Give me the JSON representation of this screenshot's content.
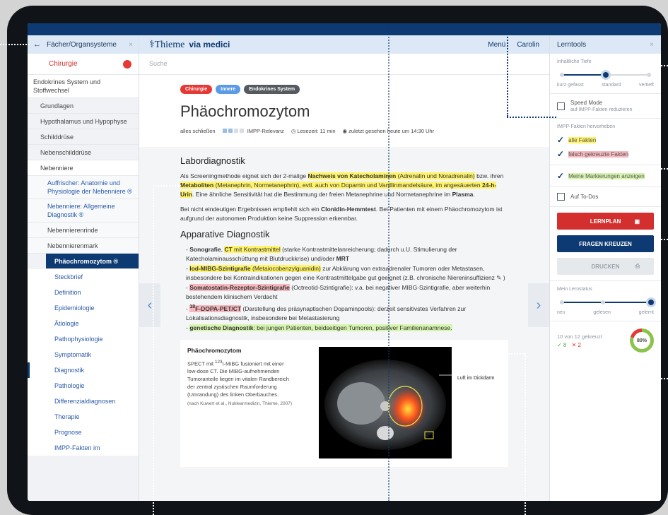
{
  "left": {
    "back_label": "Fächer/Organsysteme",
    "close": "×",
    "subject": "Chirurgie",
    "items": [
      {
        "label": "Endokrines System und Stoffwechsel"
      },
      {
        "label": "Grundlagen"
      },
      {
        "label": "Hypothalamus und Hypophyse"
      },
      {
        "label": "Schilddrüse"
      },
      {
        "label": "Nebenschilddrüse"
      },
      {
        "label": "Nebenniere"
      },
      {
        "label": "Auffrischer: Anatomie und Physiologie der Nebenniere ®"
      },
      {
        "label": "Nebenniere: Allgemeine Diagnostik ®"
      },
      {
        "label": "Nebennierenrinde"
      },
      {
        "label": "Nebennierenmark"
      },
      {
        "label": "Phäochromozytom ®"
      },
      {
        "label": "Steckbrief"
      },
      {
        "label": "Definition"
      },
      {
        "label": "Epidemiologie"
      },
      {
        "label": "Ätiologie"
      },
      {
        "label": "Pathophysiologie"
      },
      {
        "label": "Symptomatik"
      },
      {
        "label": "Diagnostik"
      },
      {
        "label": "Pathologie"
      },
      {
        "label": "Differenzialdiagnosen"
      },
      {
        "label": "Therapie"
      },
      {
        "label": "Prognose"
      },
      {
        "label": "IMPP-Fakten im"
      }
    ]
  },
  "header": {
    "logo": "Thieme",
    "logo_suffix": "via medici",
    "menu": "Menü",
    "user": "Carolin",
    "search_placeholder": "Suche"
  },
  "article": {
    "tags": [
      {
        "label": "Chirurgie",
        "color": "#e53935"
      },
      {
        "label": "Innere",
        "color": "#5b9be6"
      },
      {
        "label": "Endokrines System",
        "color": "#555a60"
      }
    ],
    "title": "Phäochromozytom",
    "close_all": "alles schließen",
    "impp": "IMPP-Relevanz",
    "impp_level": 2,
    "read_time": "Lesezeit: 11 min",
    "last_seen": "zuletzt gesehen heute um 14:30 Uhr",
    "lab_heading": "Labordiagnostik",
    "p1": {
      "a": "Als Screeningmethode eignet sich der 2-malige ",
      "b": "Nachweis von Katecholaminen",
      "c": " (Adrenalin und Noradrenalin)",
      "d": " bzw. ihren ",
      "e": "Metaboliten",
      "f": " (Metanephrin, Normetanephrin), evtl. auch von Dopamin und Vanillinmandelsäure, im angesäuerten ",
      "g": "24-h-Urin",
      "h": ". Eine ähnliche Sensitivität hat die Bestimmung der freien Metanephrine und Normetanephrine im ",
      "i": "Plasma",
      "j": "."
    },
    "p2": {
      "a": "Bei nicht eindeutigen Ergebnissen empfiehlt sich ein ",
      "b": "Clonidin-Hemmtest",
      "c": ". Bei Patienten mit einem Phäochromozytom ist aufgrund der autonomen Produktion keine Suppression erkennbar."
    },
    "app_heading": "Apparative Diagnostik",
    "items": [
      {
        "a": "Sonografie",
        "b": "CT",
        "c": " mit Kontrastmittel",
        "d": " (starke Kontrastmittelanreicherung; dadurch u.U. Stimulierung der Katecholaminausschüttung mit Blutdruckkrise) und/oder ",
        "e": "MRT"
      },
      {
        "a": "Iod-MIBG-Szintigrafie",
        "b": " (Metaiocobenzylguanidin)",
        "c": " zur Abklärung von extraadrenaler Tumoren oder Metastasen, insbesondere bei Kontraindikationen gegen eine Kontrastmittelgabe gut geeignet (z.B. chronische Niereninsuffizienz ✎ )"
      },
      {
        "a": "Somatostatin-Rezeptor-Szintigrafie",
        "b": " (Octreotid-Szintigrafie): v.a. bei negativer MIBG-Szintigrafie, aber weiterhin bestehendem klinischem Verdacht"
      },
      {
        "sup": "18",
        "a": "F-DOPA-PET/CT",
        "b": " (Darstellung des präsynaptischen Dopaminpools): derzeit sensitivstes Verfahren zur Lokalisationsdiagnostik, insbesondere bei Metastasierung"
      },
      {
        "a": "genetische Diagnostik",
        "b": ": bei jungen Patienten, beidseitigen Tumoren, positiver Familienanamnese."
      }
    ],
    "figure": {
      "title": "Phäochromozytom",
      "text_a": "SPECT mit ",
      "sup": "123",
      "text_b": "I-MIBG fusioniert mit einer low-dose CT. Die MIBG-aufnehmenden Tumoranteile liegen im vitalen Randbereich der zentral zystischen Raumforderung (Umrandung) des linken Oberbauches.",
      "source": "(nach Kuwert et al., Nuklearmedizin, Thieme, 2007)",
      "img_label": "Luft im Dickdarm"
    }
  },
  "right": {
    "title": "Lerntools",
    "close": "×",
    "depth_label": "Inhaltliche Tiefe",
    "depth_value": 0.5,
    "depth_opts": [
      "kurz gefasst",
      "standard",
      "vertieft"
    ],
    "speed_title": "Speed Mode",
    "speed_sub": "auf IMPP-Fakten reduzieren",
    "impp_label": "IMPP-Fakten hervorheben",
    "all_facts": "alle Fakten",
    "wrong_facts": "falsch gekreuzte Fakten",
    "my_marks": "Meine Markierungen anzeigen",
    "todos": "Auf To-Dos",
    "btn_plan": "LERNPLAN",
    "btn_questions": "FRAGEN KREUZEN",
    "btn_print": "DRUCKEN",
    "status_label": "Mein Lernstatus",
    "status_value": 1.0,
    "status_opts": [
      "neu",
      "gelesen",
      "gelernt"
    ],
    "crossed": "10 von 12 gekreuzt",
    "correct": "✓ 8",
    "wrong": "✕ 2",
    "percent": "80%",
    "percent_value": 0.8,
    "colors": {
      "red": "#d32f2f",
      "navy": "#0d3a72",
      "grey": "#e6e9ec"
    }
  }
}
